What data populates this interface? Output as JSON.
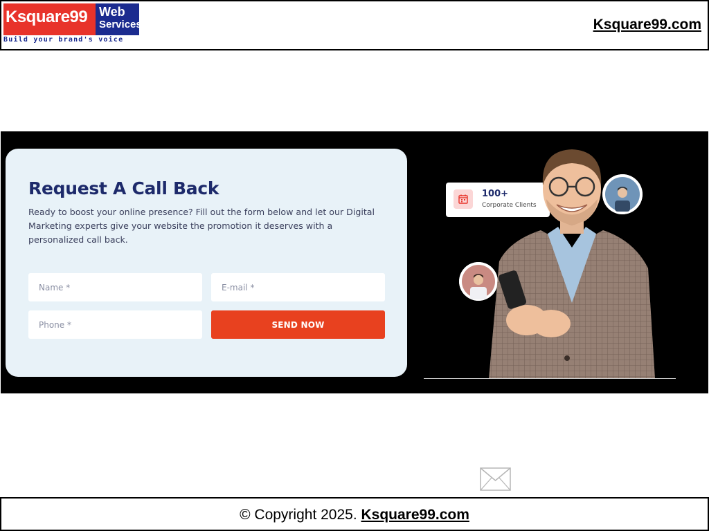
{
  "header": {
    "logo_main": "Ksquare99",
    "logo_web": "Web",
    "logo_services": "Services",
    "logo_tagline": "Build your brand's voice",
    "site_link": "Ksquare99.com"
  },
  "callback": {
    "title": "Request A Call Back",
    "description": "Ready to boost your online presence? Fill out the form below and let our Digital Marketing experts give your website the promotion it deserves with a personalized call back.",
    "name_placeholder": "Name *",
    "email_placeholder": "E-mail *",
    "phone_placeholder": "Phone *",
    "send_label": "SEND NOW"
  },
  "stat": {
    "number": "100+",
    "label": "Corporate Clients"
  },
  "footer": {
    "copyright": "© Copyright  2025. ",
    "link": "Ksquare99.com"
  },
  "colors": {
    "brand_red": "#e8332a",
    "brand_blue": "#1b2b8f",
    "button": "#e8411f",
    "card_bg": "#e8f2f8",
    "title": "#1d2a6b"
  },
  "icons": [
    "calendar-icon",
    "mail-icon"
  ]
}
